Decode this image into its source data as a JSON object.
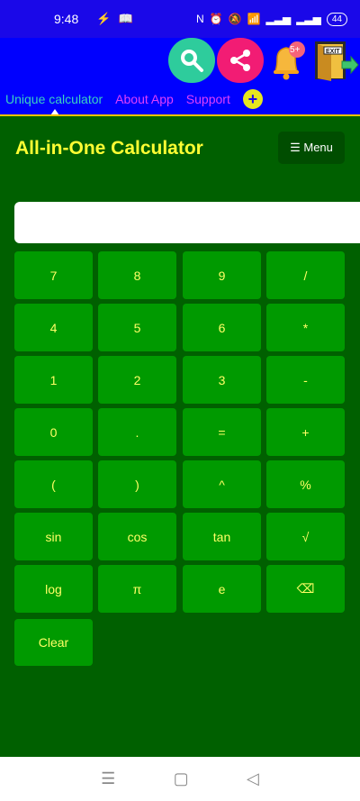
{
  "status": {
    "time": "9:48",
    "battery": "44"
  },
  "tabs": [
    {
      "label": "Unique calculator"
    },
    {
      "label": "About App"
    },
    {
      "label": "Support"
    }
  ],
  "calculator": {
    "title": "All-in-One Calculator",
    "menu_label": "☰ Menu",
    "display_value": "",
    "keys": [
      [
        "7",
        "8",
        "9",
        "/"
      ],
      [
        "4",
        "5",
        "6",
        "*"
      ],
      [
        "1",
        "2",
        "3",
        "-"
      ],
      [
        "0",
        ".",
        "=",
        "+"
      ],
      [
        "(",
        ")",
        "^",
        "%"
      ],
      [
        "sin",
        "cos",
        "tan",
        "√"
      ],
      [
        "log",
        "π",
        "e",
        "⌫"
      ],
      [
        "Clear"
      ]
    ]
  },
  "icons": {
    "search": "search-icon",
    "share": "share-icon",
    "bell": "notification-bell-icon",
    "exit": "exit-door-icon",
    "add": "plus-icon"
  },
  "badges": {
    "bell_count": "5+"
  },
  "colors": {
    "appbar": "#0000fe",
    "calc_bg": "#006000",
    "key_bg": "#009a00",
    "key_text": "#ffff66",
    "title": "#ffff33"
  }
}
